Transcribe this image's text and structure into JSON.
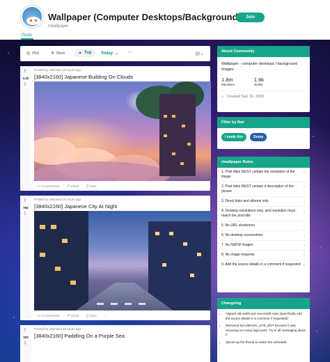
{
  "header": {
    "title": "Wallpaper (Computer Desktops/Backgrounds)",
    "subreddit": "r/wallpaper",
    "join_label": "Join",
    "tab_posts": "Posts",
    "accent": "#17a589"
  },
  "sortbar": {
    "hot": "Hot",
    "new": "New",
    "top": "Top",
    "range": "Today",
    "more": "···"
  },
  "posts": [
    {
      "score": "3.1k",
      "meta": "Posted by u/wimwei 19 hours ago",
      "title": "[3840x2160] Japanese Building On Clouds",
      "comments": "9 Comments",
      "share": "Share",
      "save": "Save",
      "more": "···"
    },
    {
      "score": "762",
      "meta": "Posted by u/wimwei 15 hours ago",
      "title": "[3840x2160] Japanese City At Night",
      "comments": "5 Comments",
      "share": "Share",
      "save": "Save",
      "more": "···"
    },
    {
      "score": "322",
      "meta": "Posted by u/wimwei 15 hours ago",
      "title": "[3840x2160] Paddling On a Purple Sea"
    }
  ],
  "about": {
    "heading": "About Community",
    "description": "Wallpaper - computer desktops / background images",
    "members_value": "1.8m",
    "members_label": "Members",
    "online_value": "1.9k",
    "online_label": "Online",
    "created": "Created Sep 16, 2008"
  },
  "flair": {
    "heading": "Filter by flair",
    "items": [
      "I made this",
      "Dump"
    ]
  },
  "rules": {
    "heading": "r/wallpaper Rules",
    "items": [
      "1. Post titles MUST contain the resolution of the image",
      "2. Post titles MUST contain a description of the picture",
      "3. Direct links and albums only",
      "4. Desktop resolutions only, and resolution must match the post title",
      "5. No URL shorteners",
      "6. No desktop screenshots",
      "7. No NSFW images",
      "8. No image requests",
      "9. Add the source details in a comment if requested"
    ]
  },
  "changelog": {
    "heading": "Changelog",
    "items": [
      "Aligned old.reddit and new.reddit rules (specifically Add the source details in a comment if requested)",
      "Removed bot u/MAGIC_EYE_BOT because it was removing too many legit posts. Try to all messaging about it.",
      "Spiced up the theme to match the subreddit."
    ]
  }
}
